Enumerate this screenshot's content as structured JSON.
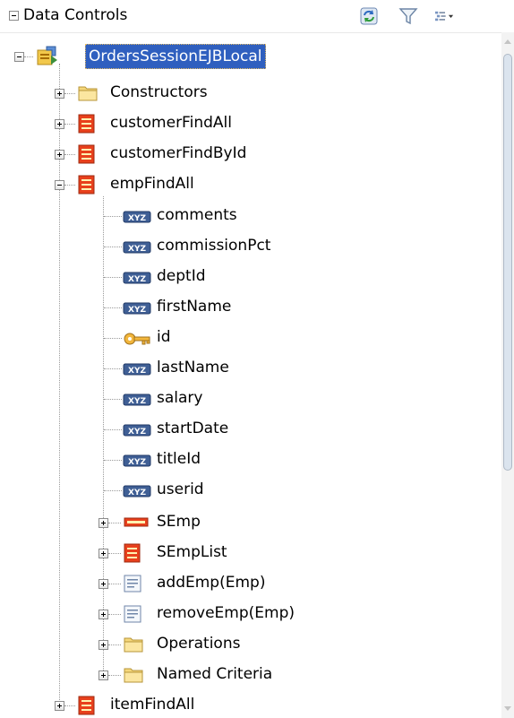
{
  "panel": {
    "title": "Data Controls",
    "toolbar_icons": [
      "refresh-icon",
      "filter-icon",
      "view-options-icon"
    ]
  },
  "tree": {
    "root": "OrdersSessionEJBLocal",
    "level1": [
      "Constructors",
      "customerFindAll",
      "customerFindById",
      "empFindAll",
      "itemFindAll"
    ],
    "emp_attributes": [
      "comments",
      "commissionPct",
      "deptId",
      "firstName",
      "id",
      "lastName",
      "salary",
      "startDate",
      "titleId",
      "userid"
    ],
    "emp_children": [
      "SEmp",
      "SEmpList",
      "addEmp(Emp)",
      "removeEmp(Emp)",
      "Operations",
      "Named Criteria"
    ]
  },
  "colors": {
    "selection": "#2f5fbf",
    "collection_icon": "#e8401c",
    "folder": "#f5d77a"
  }
}
